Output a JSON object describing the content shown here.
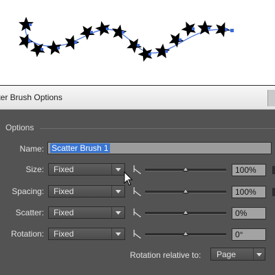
{
  "artboard": {
    "star_color": "#000000",
    "selection_color": "#3d6bd8"
  },
  "dialog": {
    "title": "tter Brush Options",
    "group_label": "Options",
    "name": {
      "label": "Name:",
      "value": "Scatter Brush 1"
    },
    "rows": [
      {
        "label": "Size:",
        "method": "Fixed",
        "value": "100%",
        "level": 0.5
      },
      {
        "label": "Spacing:",
        "method": "Fixed",
        "value": "100%",
        "level": 0.5
      },
      {
        "label": "Scatter:",
        "method": "Fixed",
        "value": "0%",
        "level": 0.5
      },
      {
        "label": "Rotation:",
        "method": "Fixed",
        "value": "0°",
        "level": 0.5
      }
    ],
    "rotation_relative": {
      "label": "Rotation relative to:",
      "value": "Page"
    }
  },
  "icons": {
    "dropdown": "chevron-down-icon",
    "pressure": "pressure-icon",
    "cursor": "mouse-pointer-icon"
  }
}
